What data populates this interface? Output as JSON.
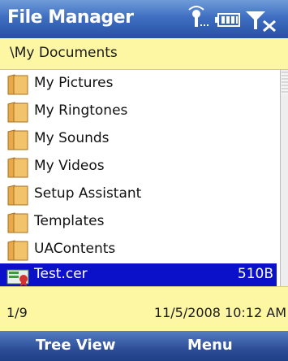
{
  "header": {
    "title": "File Manager"
  },
  "path": {
    "current": "\\My Documents"
  },
  "files": [
    {
      "name": "My Pictures",
      "type": "folder"
    },
    {
      "name": "My Ringtones",
      "type": "folder"
    },
    {
      "name": "My Sounds",
      "type": "folder"
    },
    {
      "name": "My Videos",
      "type": "folder"
    },
    {
      "name": "Setup Assistant",
      "type": "folder"
    },
    {
      "name": "Templates",
      "type": "folder"
    },
    {
      "name": "UAContents",
      "type": "folder"
    },
    {
      "name": "Test.cer",
      "type": "file",
      "size": "510B",
      "selected": true
    }
  ],
  "status": {
    "page_indicator": "1/9",
    "datetime": "11/5/2008 10:12 AM"
  },
  "softkeys": {
    "left": "Tree View",
    "right": "Menu"
  },
  "colors": {
    "title_bar": "#3f6fc2",
    "path_bar": "#fdf6a2",
    "selection": "#0b10c9",
    "folder": "#f2c36b"
  },
  "icons": {
    "connectivity": "connectivity-icon",
    "battery": "battery-icon",
    "signal": "signal-no-service-icon",
    "folder": "folder-icon",
    "certificate": "certificate-file-icon"
  }
}
